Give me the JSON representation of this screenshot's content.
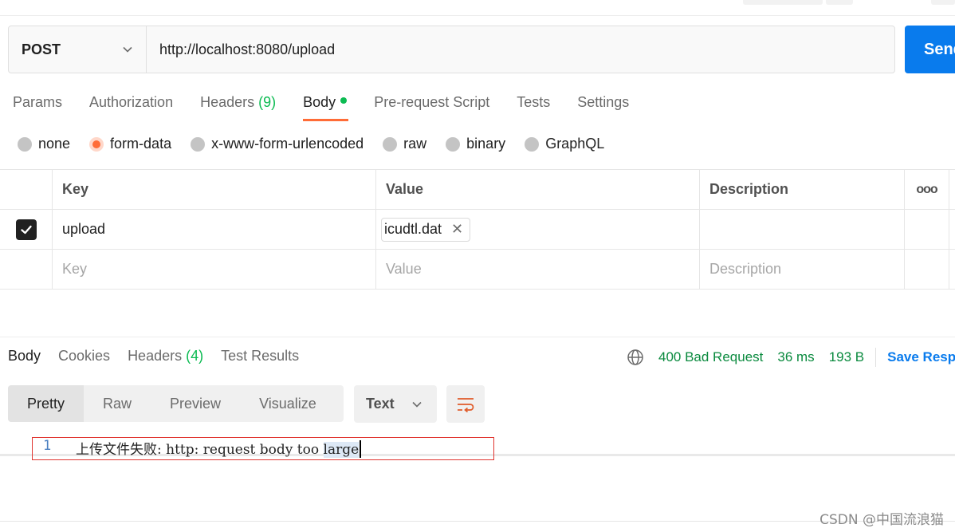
{
  "request": {
    "method": "POST",
    "url": "http://localhost:8080/upload",
    "send_label": "Send"
  },
  "request_tabs": [
    {
      "label": "Params",
      "count": ""
    },
    {
      "label": "Authorization",
      "count": ""
    },
    {
      "label": "Headers",
      "count": "(9)"
    },
    {
      "label": "Body",
      "count": ""
    },
    {
      "label": "Pre-request Script",
      "count": ""
    },
    {
      "label": "Tests",
      "count": ""
    },
    {
      "label": "Settings",
      "count": ""
    }
  ],
  "body_types": [
    "none",
    "form-data",
    "x-www-form-urlencoded",
    "raw",
    "binary",
    "GraphQL"
  ],
  "table": {
    "headers": {
      "key": "Key",
      "value": "Value",
      "description": "Description",
      "more": "ooo"
    },
    "rows": [
      {
        "key": "upload",
        "value_file": "icudtl.dat",
        "description": ""
      }
    ],
    "placeholders": {
      "key": "Key",
      "value": "Value",
      "description": "Description"
    }
  },
  "response": {
    "tabs": [
      {
        "label": "Body",
        "count": ""
      },
      {
        "label": "Cookies",
        "count": ""
      },
      {
        "label": "Headers",
        "count": "(4)"
      },
      {
        "label": "Test Results",
        "count": ""
      }
    ],
    "status": "400 Bad Request",
    "time": "36 ms",
    "size": "193 B",
    "save_label": "Save Response",
    "views": [
      "Pretty",
      "Raw",
      "Preview",
      "Visualize"
    ],
    "format": "Text",
    "lines": [
      {
        "number": "1",
        "text_plain": "上传文件失败: http: request body too ",
        "text_highlight": "large"
      }
    ]
  },
  "watermark": "CSDN @中国流浪猫",
  "colors": {
    "accent": "#ff6c37",
    "send": "#097bed",
    "success": "#0cbb52"
  }
}
